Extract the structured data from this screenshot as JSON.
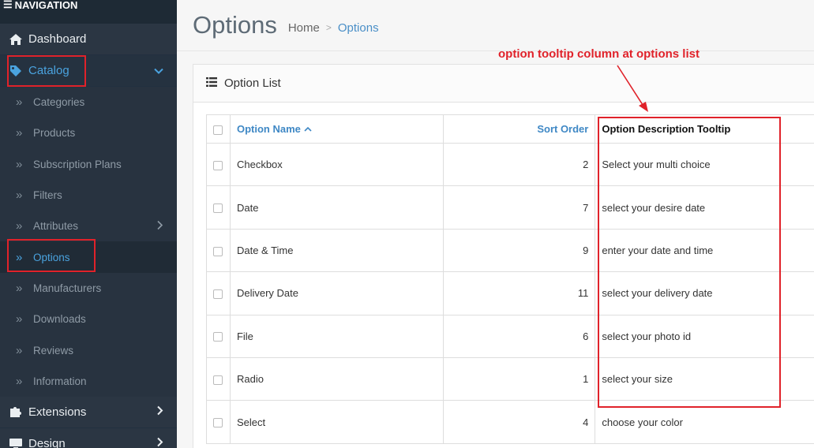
{
  "nav": {
    "header": "NAVIGATION",
    "items": [
      {
        "label": "Dashboard",
        "icon": "home-icon"
      },
      {
        "label": "Catalog",
        "icon": "tag-icon"
      },
      {
        "label": "Extensions",
        "icon": "puzzle-icon"
      },
      {
        "label": "Design",
        "icon": "monitor-icon"
      }
    ],
    "catalog_children": [
      {
        "label": "Categories"
      },
      {
        "label": "Products"
      },
      {
        "label": "Subscription Plans"
      },
      {
        "label": "Filters"
      },
      {
        "label": "Attributes"
      },
      {
        "label": "Options"
      },
      {
        "label": "Manufacturers"
      },
      {
        "label": "Downloads"
      },
      {
        "label": "Reviews"
      },
      {
        "label": "Information"
      }
    ]
  },
  "page": {
    "title": "Options",
    "breadcrumb": [
      "Home",
      "Options"
    ]
  },
  "panel": {
    "title": "Option List"
  },
  "table": {
    "headers": {
      "name": "Option Name",
      "sort": "Sort Order",
      "tooltip": "Option Description Tooltip"
    },
    "rows": [
      {
        "name": "Checkbox",
        "sort": "2",
        "tooltip": "Select your multi choice"
      },
      {
        "name": "Date",
        "sort": "7",
        "tooltip": "select your desire date"
      },
      {
        "name": "Date & Time",
        "sort": "9",
        "tooltip": "enter your date and time"
      },
      {
        "name": "Delivery Date",
        "sort": "11",
        "tooltip": "select your delivery date"
      },
      {
        "name": "File",
        "sort": "6",
        "tooltip": "select your photo id"
      },
      {
        "name": "Radio",
        "sort": "1",
        "tooltip": "select your size"
      },
      {
        "name": "Select",
        "sort": "4",
        "tooltip": "choose your color"
      }
    ]
  },
  "annotation": {
    "text": "option tooltip column at options list",
    "color": "#e0222a"
  },
  "colors": {
    "sidebar_bg": "#2b3643",
    "accent": "#4aa3df",
    "link": "#3f88c5"
  }
}
